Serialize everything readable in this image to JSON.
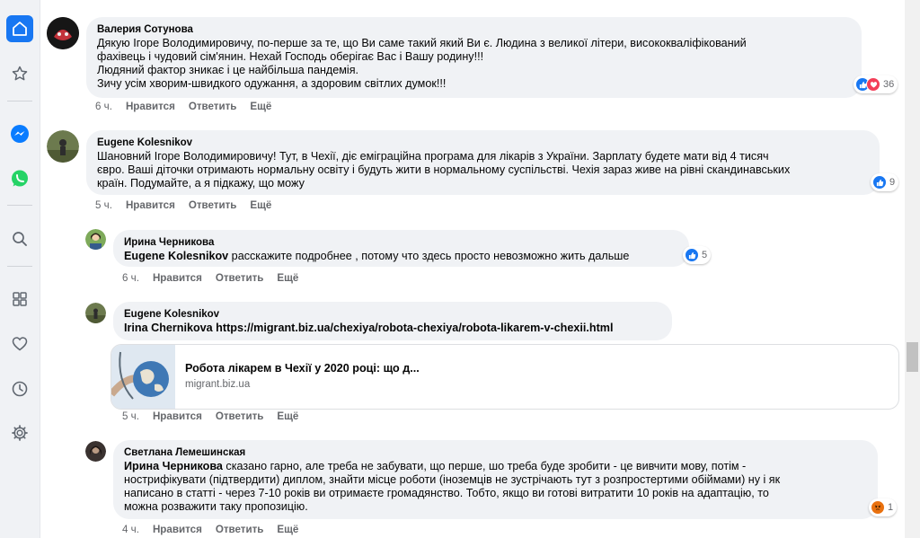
{
  "comments": [
    {
      "author": "Валерия Сотунова",
      "lines": [
        "Дякую Ігоре Володимировичу, по-перше за те, що Ви саме такий який Ви є. Людина з великої літери, висококваліфікований",
        "фахівець і чудовий сім'янин. Нехай Господь оберігає Вас і Вашу родину!!!",
        "Людяний фактор зникає і це найбільша пандемія.",
        "Зичу усім хворим-швидкого одужання, а здоровим світлих думок!!!"
      ],
      "time": "6 ч.",
      "like": "Нравится",
      "reply": "Ответить",
      "more": "Ещё",
      "reactions": "36"
    },
    {
      "author": "Eugene Kolesnikov",
      "lines": [
        "Шановний Ігоре Володимировичу! Тут, в Чехії, діє еміграційна програма для лікарів з України. Зарплату будете мати від 4 тисяч",
        "євро. Ваші діточки отримають нормальну освіту і будуть жити в нормальному суспільстві. Чехія зараз живе на рівні скандинавських",
        "країн. Подумайте, а я підкажу, що можу"
      ],
      "time": "5 ч.",
      "like": "Нравится",
      "reply": "Ответить",
      "more": "Ещё",
      "reactions": "9"
    }
  ],
  "replies": [
    {
      "author": "Ирина Черникова",
      "mention": "Eugene Kolesnikov",
      "text": " расскажите подробнее , потому что здесь просто невозможно жить дальше",
      "time": "6 ч.",
      "like": "Нравится",
      "reply": "Ответить",
      "more": "Ещё",
      "reactions": "5"
    },
    {
      "author": "Eugene Kolesnikov",
      "mention": "Irina Chernikova",
      "link": " https://migrant.biz.ua/chexiya/robota-chexiya/robota-likarem-v-chexii.html",
      "preview_title": "Робота лікарем в Чехії у 2020 році: що д...",
      "preview_domain": "migrant.biz.ua",
      "time": "5 ч.",
      "like": "Нравится",
      "reply": "Ответить",
      "more": "Ещё"
    },
    {
      "author": "Светлана Лемешинская",
      "mention": "Ирина Черникова",
      "lines": [
        " сказано гарно, але треба не забувати, що перше, шо треба буде зробити - це вивчити мову, потім -",
        "нострифікувати (підтвердити) диплом, знайти місце роботи (іноземців не зустрічають тут з розпростертими обіймами) ну і як",
        "написано в статті - через 7-10 років ви отримаєте громадянство. Тобто, якщо ви готові витратити 10 років на адаптацію, то",
        "можна розважити таку пропозицію."
      ],
      "time": "4 ч.",
      "like": "Нравится",
      "reply": "Ответить",
      "more": "Ещё",
      "reactions": "1"
    }
  ],
  "sidebar": {
    "icons": [
      "home-icon",
      "star-icon",
      "messenger-icon",
      "whatsapp-icon",
      "search-icon",
      "apps-icon",
      "heart-icon",
      "clock-icon",
      "settings-icon"
    ]
  },
  "colors": {
    "accent": "#1877f2",
    "bubble": "#f0f2f5",
    "love": "#f33e58",
    "angry": "#e9710f"
  }
}
